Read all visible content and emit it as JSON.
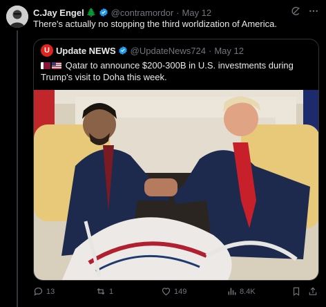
{
  "tweet": {
    "author_name": "C.Jay Engel",
    "author_emoji": "🌲",
    "handle": "@contramordor",
    "separator": "·",
    "date": "May 12",
    "text": "There's actually no stopping the third worldization of America."
  },
  "quote": {
    "logo_letter": "U",
    "author_name": "Update NEWS",
    "handle": "@UpdateNews724",
    "separator": "·",
    "date": "May 12",
    "text": "Qatar to announce $200-300B in U.S. investments during Trump's visit to Doha this week."
  },
  "actions": {
    "replies": "13",
    "reposts": "1",
    "likes": "149",
    "views": "8.4K"
  },
  "colors": {
    "background": "#000000",
    "text": "#e7e9ea",
    "muted": "#71767b",
    "verified": "#1d9bf0",
    "border": "#2f3336",
    "logo": "#e0231d"
  }
}
